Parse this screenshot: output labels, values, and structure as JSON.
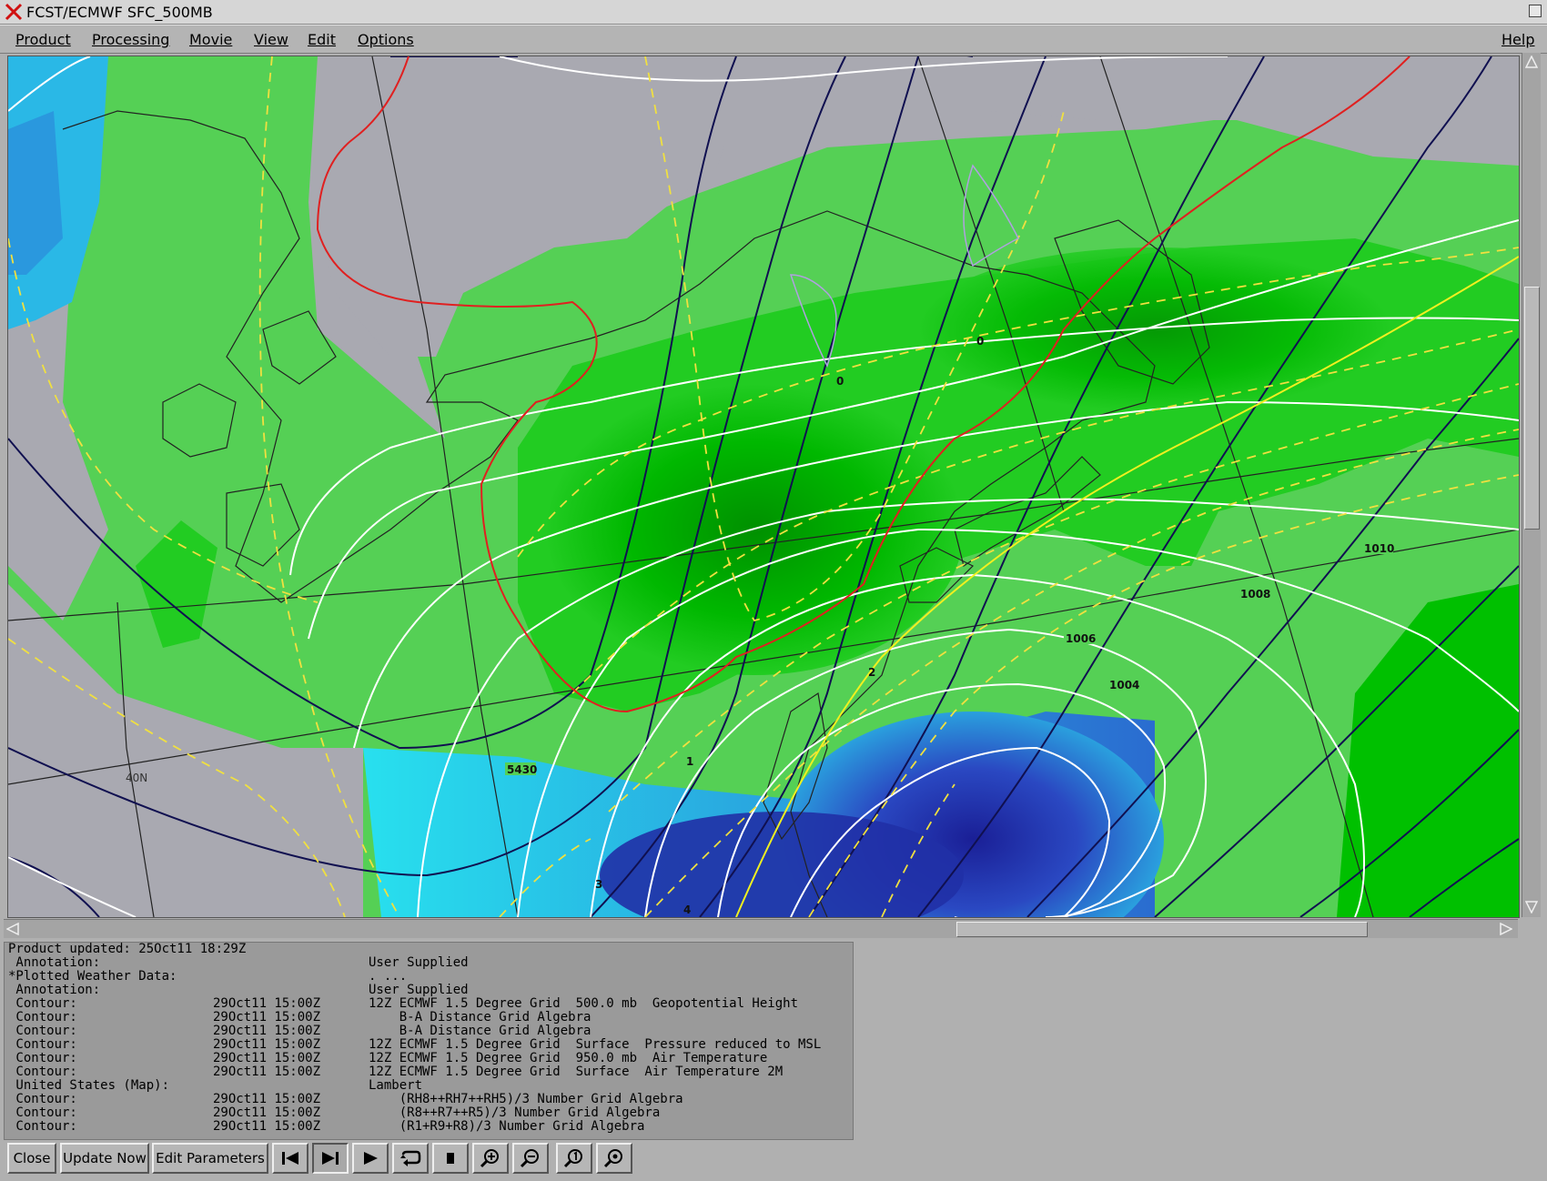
{
  "window": {
    "title": "FCST/ECMWF SFC_500MB"
  },
  "menubar": {
    "items": [
      {
        "label": "Product"
      },
      {
        "label": "Processing"
      },
      {
        "label": "Movie"
      },
      {
        "label": "View"
      },
      {
        "label": "Edit"
      },
      {
        "label": "Options"
      }
    ],
    "help": "Help"
  },
  "map": {
    "labels": {
      "isobar_1010": "1010",
      "isobar_1008": "1008",
      "isobar_1006": "1006",
      "isobar_1004": "1004",
      "height_5430": "5430",
      "temp_0_a": "0",
      "temp_0_b": "0",
      "temp_2": "2",
      "temp_1": "1",
      "temp_3": "3",
      "temp_4": "4",
      "lat_40n": "40N"
    },
    "colors": {
      "background": "#a9a9b1",
      "light_green": "#55d055",
      "bright_green": "#22cc22",
      "dark_green": "#00a800",
      "cyan": "#2ad6e6",
      "blue": "#2a4ec6",
      "dark_blue": "#1e2ea0",
      "isobar": "#ffffff",
      "height_contour": "#101050",
      "temp_dashed": "#f0e040",
      "freezing_line": "#e02020"
    }
  },
  "info": {
    "lines": [
      [
        "Product updated: 25Oct11 18:29Z",
        "",
        ""
      ],
      [
        " Annotation:",
        "",
        "User Supplied"
      ],
      [
        "*Plotted Weather Data:",
        "",
        ". ..."
      ],
      [
        " Annotation:",
        "",
        "User Supplied"
      ],
      [
        " Contour:",
        "29Oct11 15:00Z",
        "12Z ECMWF 1.5 Degree Grid  500.0 mb  Geopotential Height"
      ],
      [
        " Contour:",
        "29Oct11 15:00Z",
        "    B-A Distance Grid Algebra"
      ],
      [
        " Contour:",
        "29Oct11 15:00Z",
        "    B-A Distance Grid Algebra"
      ],
      [
        " Contour:",
        "29Oct11 15:00Z",
        "12Z ECMWF 1.5 Degree Grid  Surface  Pressure reduced to MSL"
      ],
      [
        " Contour:",
        "29Oct11 15:00Z",
        "12Z ECMWF 1.5 Degree Grid  950.0 mb  Air Temperature"
      ],
      [
        " Contour:",
        "29Oct11 15:00Z",
        "12Z ECMWF 1.5 Degree Grid  Surface  Air Temperature 2M"
      ],
      [
        " United States (Map):",
        "",
        "Lambert"
      ],
      [
        " Contour:",
        "29Oct11 15:00Z",
        "    (RH8++RH7++RH5)/3 Number Grid Algebra"
      ],
      [
        " Contour:",
        "29Oct11 15:00Z",
        "    (R8++R7++R5)/3 Number Grid Algebra"
      ],
      [
        " Contour:",
        "29Oct11 15:00Z",
        "    (R1+R9+R8)/3 Number Grid Algebra"
      ]
    ]
  },
  "toolbar": {
    "close_label": "Close",
    "update_label": "Update Now",
    "edit_params_label": "Edit Parameters",
    "icons": [
      "first-frame-icon",
      "step-forward-icon",
      "play-icon",
      "loop-icon",
      "stop-icon",
      "zoom-in-icon",
      "zoom-out-icon",
      "zoom-reset-icon",
      "zoom-fit-icon"
    ]
  }
}
